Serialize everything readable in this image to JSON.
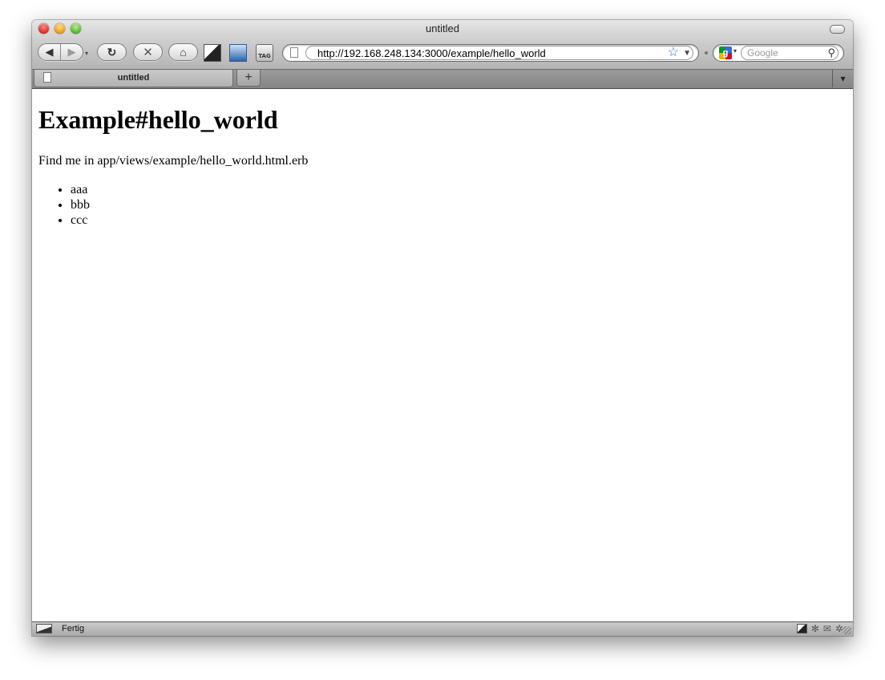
{
  "window": {
    "title": "untitled"
  },
  "toolbar": {
    "back_glyph": "◀",
    "forward_glyph": "▶",
    "dropdown_glyph": "▾",
    "reload_glyph": "↻",
    "stop_glyph": "✕",
    "home_glyph": "⌂",
    "tag_label": "TAG",
    "icons": [
      "back-icon",
      "forward-icon",
      "reload-icon",
      "stop-icon",
      "home-icon",
      "page-toggle-icon",
      "bookmark-icon",
      "tag-icon"
    ]
  },
  "address_bar": {
    "url": "http://192.168.248.134:3000/example/hello_world",
    "star_glyph": "☆",
    "dropdown_glyph": "▼"
  },
  "search_bar": {
    "engine_glyph": "g",
    "placeholder": "Google",
    "dropdown_glyph": "▾",
    "magnifier_glyph": "⚲"
  },
  "tabs": {
    "items": [
      {
        "label": "untitled"
      }
    ],
    "new_tab_glyph": "+",
    "list_glyph": "▾"
  },
  "page": {
    "heading": "Example#hello_world",
    "paragraph": "Find me in app/views/example/hello_world.html.erb",
    "items": [
      "aaa",
      "bbb",
      "ccc"
    ]
  },
  "status": {
    "text": "Fertig",
    "tray_glyphs": [
      "✻",
      "✉",
      "✲"
    ]
  }
}
